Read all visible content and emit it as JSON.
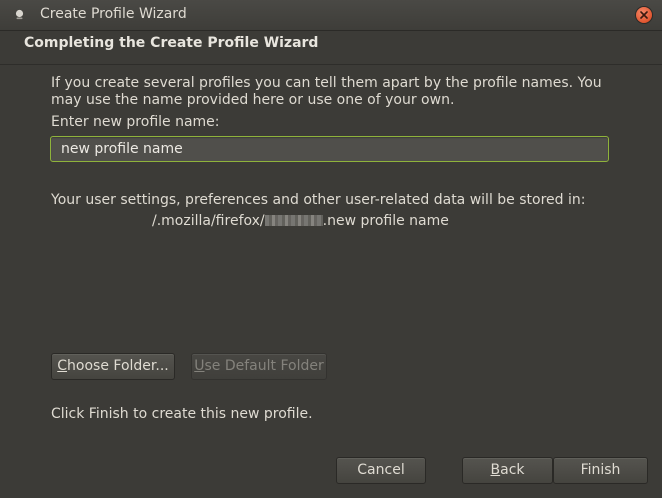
{
  "window": {
    "title": "Create Profile Wizard",
    "accent_color": "#8fb33b",
    "close_color": "#e0552f"
  },
  "header": {
    "title": "Completing the Create Profile Wizard"
  },
  "main": {
    "intro": "If you create several profiles you can tell them apart by the profile names. You may use the name provided here or use one of your own.",
    "name_label": "Enter new profile name:",
    "name_value": "new profile name",
    "storage_text": "Your user settings, preferences and other user-related data will be stored in:",
    "path_prefix": "/.mozilla/firefox/",
    "path_suffix": ".new profile name",
    "choose_folder_mnemonic": "C",
    "choose_folder_rest": "hoose Folder...",
    "use_default_mnemonic": "U",
    "use_default_rest": "se Default Folder",
    "finish_hint": "Click Finish to create this new profile."
  },
  "footer": {
    "cancel_label": "Cancel",
    "back_mnemonic": "B",
    "back_rest": "ack",
    "finish_label": "Finish"
  },
  "icons": {
    "app": "firefox-profile-icon",
    "close": "close-icon"
  }
}
